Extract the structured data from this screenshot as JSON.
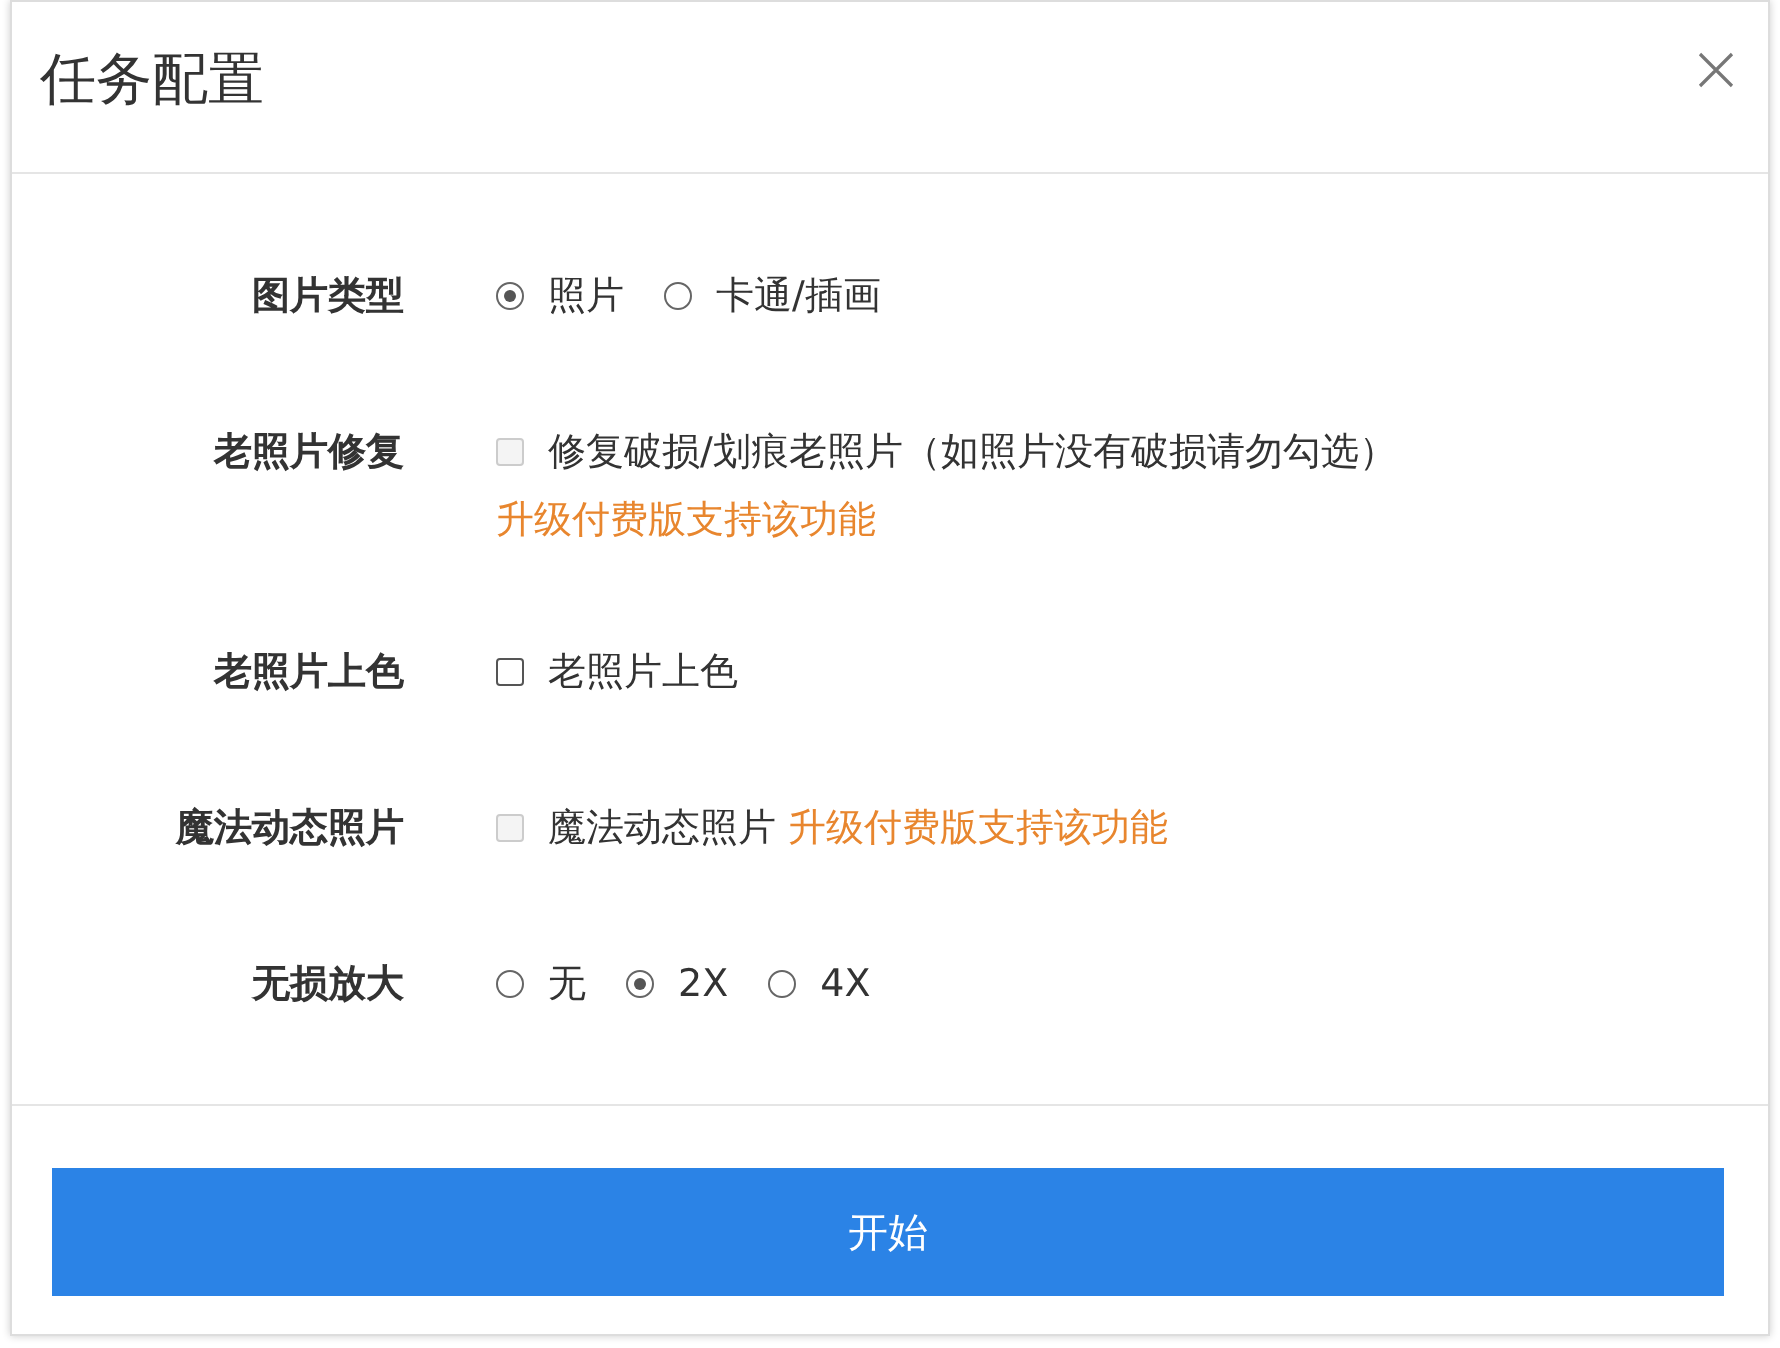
{
  "dialog": {
    "title": "任务配置"
  },
  "rows": [
    {
      "label": "图片类型",
      "kind": "radio",
      "options": [
        {
          "label": "照片",
          "selected": true
        },
        {
          "label": "卡通/插画",
          "selected": false
        }
      ]
    },
    {
      "label": "老照片修复",
      "kind": "checkbox",
      "checkbox": {
        "label": "修复破损/划痕老照片（如照片没有破损请勿勾选）",
        "checked": false,
        "disabled": true
      },
      "note": "升级付费版支持该功能",
      "note_inline": false
    },
    {
      "label": "老照片上色",
      "kind": "checkbox",
      "checkbox": {
        "label": "老照片上色",
        "checked": false,
        "disabled": false
      }
    },
    {
      "label": "魔法动态照片",
      "kind": "checkbox",
      "checkbox": {
        "label": "魔法动态照片",
        "checked": false,
        "disabled": true
      },
      "note": "升级付费版支持该功能",
      "note_inline": true
    },
    {
      "label": "无损放大",
      "kind": "radio",
      "options": [
        {
          "label": "无",
          "selected": false
        },
        {
          "label": "2X",
          "selected": true
        },
        {
          "label": "4X",
          "selected": false
        }
      ]
    }
  ],
  "start_button": "开始"
}
